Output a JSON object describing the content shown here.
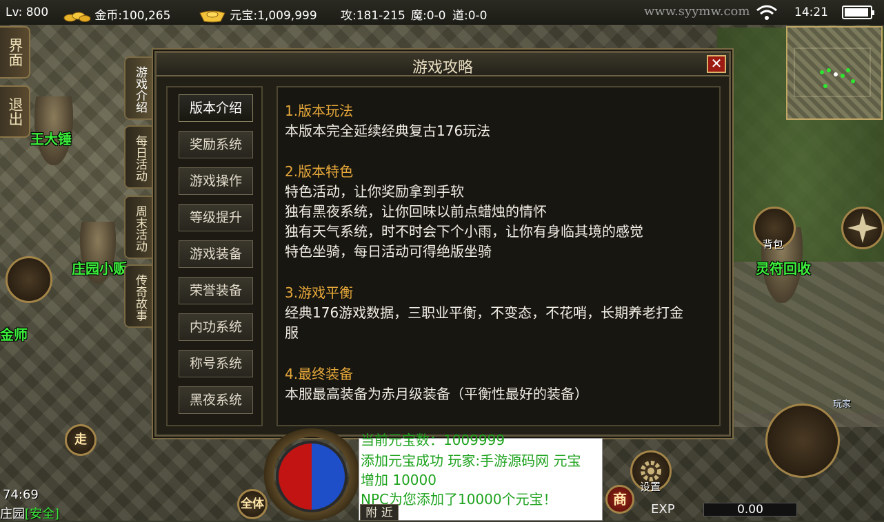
{
  "status_bar": {
    "level": "Lv: 800",
    "gold_label": "金币:",
    "gold_value": "100,265",
    "yuanbao_label": "元宝:",
    "yuanbao_value": "1,009,999",
    "attack": "攻:181-215",
    "magic": "魔:0-0",
    "tao": "道:0-0",
    "watermark": "www.syymw.com",
    "time": "14:21",
    "battery_level_percent": 95
  },
  "side_buttons": [
    "界面",
    "退出"
  ],
  "dialog": {
    "title": "游戏攻略",
    "close_label": "✕",
    "vertical_tabs": [
      "游戏介绍",
      "每日活动",
      "周末活动",
      "传奇故事"
    ],
    "active_tab": 0,
    "menu_items": [
      "版本介绍",
      "奖励系统",
      "游戏操作",
      "等级提升",
      "游戏装备",
      "荣誉装备",
      "内功系统",
      "称号系统",
      "黑夜系统"
    ],
    "active_menu": 0,
    "sections": [
      {
        "title": "1.版本玩法",
        "lines": [
          "本版本完全延续经典复古176玩法"
        ]
      },
      {
        "title": "2.版本特色",
        "lines": [
          "特色活动，让你奖励拿到手软",
          "独有黑夜系统，让你回味以前点蜡烛的情怀",
          "独有天气系统，时不时会下个小雨，让你有身临其境的感觉",
          "特色坐骑，每日活动可得绝版坐骑"
        ]
      },
      {
        "title": "3.游戏平衡",
        "lines": [
          "经典176游戏数据，三职业平衡，不变态，不花哨，长期养老打金",
          "服"
        ]
      },
      {
        "title": "4.最终装备",
        "lines": [
          "本服最高装备为赤月级装备（平衡性最好的装备）"
        ]
      }
    ]
  },
  "npcs": [
    "王大锤",
    "庄园小贩",
    "金师",
    "灵符回收"
  ],
  "right_labels": {
    "bag": "背包",
    "player": "玩家",
    "settings": "设置"
  },
  "chat": {
    "lines": [
      "当前元宝数：1009999",
      "添加元宝成功 玩家:手游源码网 元宝",
      "增加 10000",
      "NPC为您添加了10000个元宝！"
    ],
    "tab_label": "附 近"
  },
  "bottom": {
    "coords": "74:69",
    "location": "庄园",
    "safe": "[安全]",
    "walk_label": "走",
    "all_label": "全体",
    "shop_label": "商",
    "exp_label": "EXP",
    "exp_value": "0.00"
  },
  "colors": {
    "npc_name": "#3cf03c",
    "section_title": "#e6a83a",
    "chat_text": "#1fa31f"
  }
}
